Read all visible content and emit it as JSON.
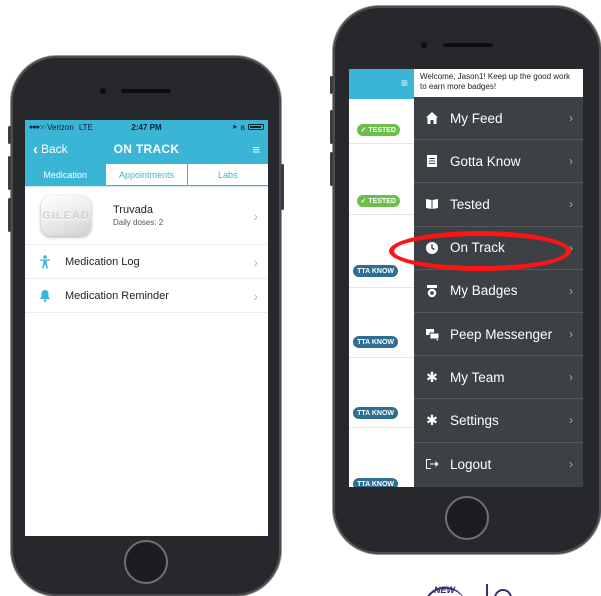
{
  "left_phone": {
    "status_bar": {
      "carrier": "Verizon",
      "network": "LTE",
      "time": "2:47 PM"
    },
    "nav": {
      "back_label": "Back",
      "title": "ON TRACK"
    },
    "tabs": [
      {
        "label": "Medication",
        "active": true
      },
      {
        "label": "Appointments",
        "active": false
      },
      {
        "label": "Labs",
        "active": false
      }
    ],
    "medication": {
      "name": "Truvada",
      "doses": "Daily doses: 2",
      "pill_imprint": "GILEAD"
    },
    "list": [
      {
        "label": "Medication Log",
        "icon": "person-icon"
      },
      {
        "label": "Medication Reminder",
        "icon": "bell-icon"
      }
    ]
  },
  "right_phone": {
    "feed_tags": [
      "TESTED",
      "TESTED",
      "TTA KNOW",
      "TTA KNOW",
      "TTA KNOW",
      "TTA KNOW"
    ],
    "drawer": {
      "welcome": "Welcome, Jason1! Keep up the good work to earn more badges!",
      "items": [
        {
          "label": "My Feed",
          "icon": "home-icon"
        },
        {
          "label": "Gotta Know",
          "icon": "document-icon"
        },
        {
          "label": "Tested",
          "icon": "book-icon"
        },
        {
          "label": "On Track",
          "icon": "clock-icon"
        },
        {
          "label": "My Badges",
          "icon": "badge-icon"
        },
        {
          "label": "Peep Messenger",
          "icon": "chat-icon"
        },
        {
          "label": "My Team",
          "icon": "gear-icon"
        },
        {
          "label": "Settings",
          "icon": "gear-icon"
        },
        {
          "label": "Logout",
          "icon": "logout-icon"
        }
      ]
    }
  },
  "logo": {
    "text": "NEW"
  },
  "colors": {
    "accent": "#3ab5d6",
    "drawer_bg": "#3d4045",
    "highlight": "#ff1414",
    "tag_green": "#6cc04a",
    "tag_blue": "#2f6d93"
  }
}
